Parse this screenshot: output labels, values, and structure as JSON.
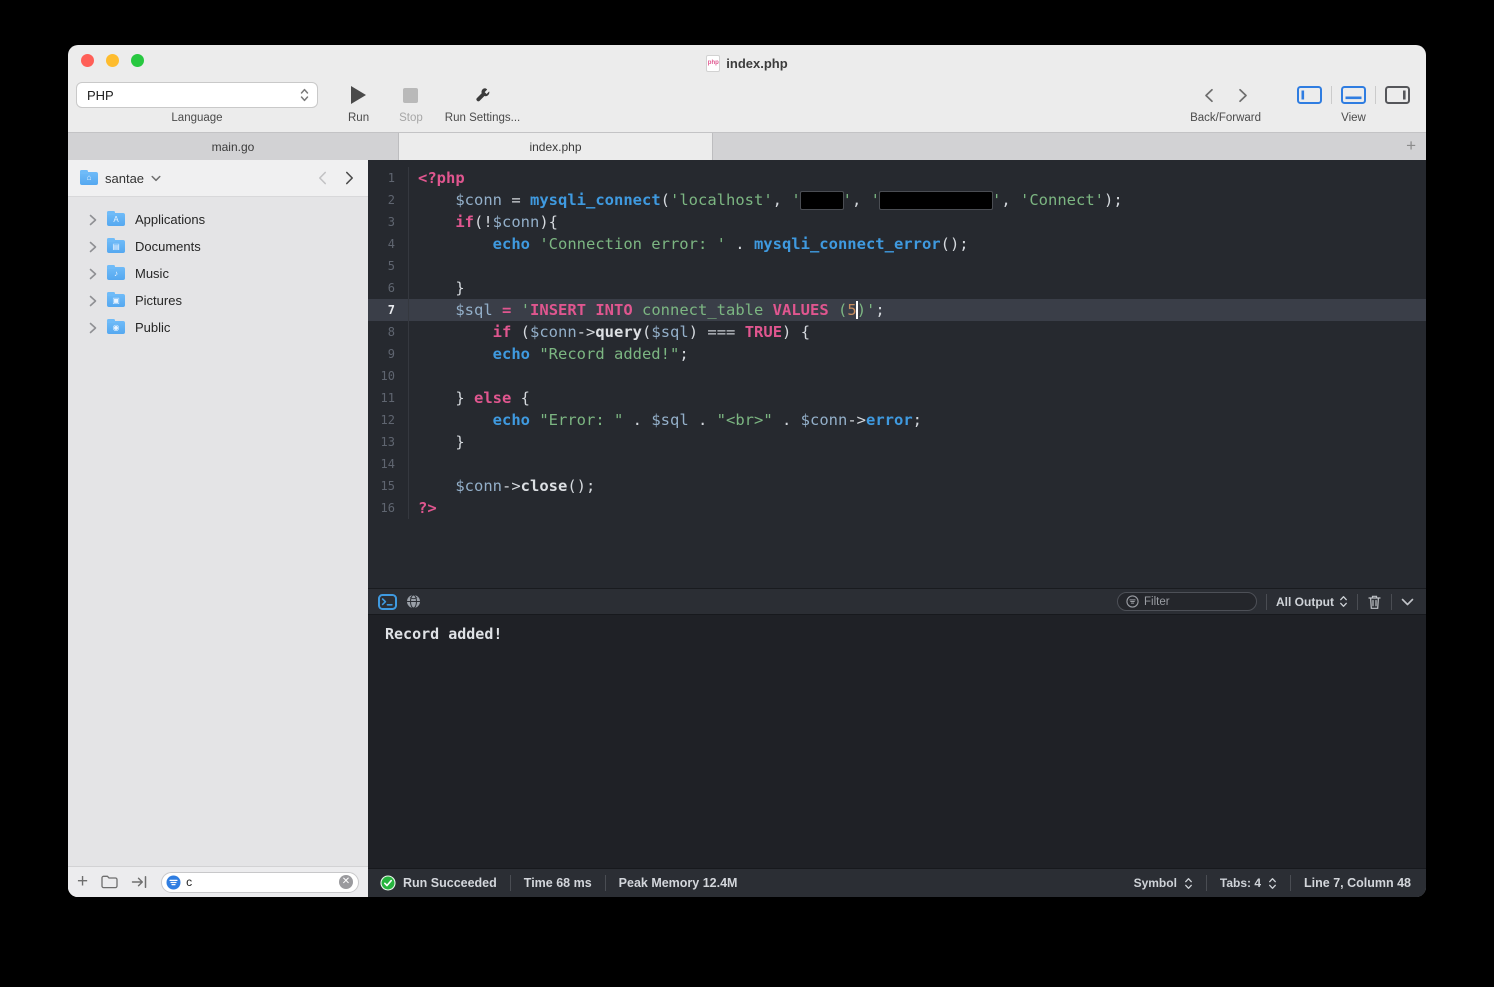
{
  "window": {
    "title": "index.php",
    "file_icon_label": "php"
  },
  "toolbar": {
    "language_value": "PHP",
    "language_label": "Language",
    "run_label": "Run",
    "stop_label": "Stop",
    "run_settings_label": "Run Settings...",
    "back_forward_label": "Back/Forward",
    "view_label": "View"
  },
  "tabs": [
    {
      "label": "main.go",
      "active": false
    },
    {
      "label": "index.php",
      "active": true
    }
  ],
  "tab_add_label": "+",
  "sidebar": {
    "root_label": "santae",
    "items": [
      {
        "label": "Applications",
        "glyph": "A"
      },
      {
        "label": "Documents",
        "glyph": "▤"
      },
      {
        "label": "Music",
        "glyph": "♪"
      },
      {
        "label": "Pictures",
        "glyph": "▣"
      },
      {
        "label": "Public",
        "glyph": "◉"
      }
    ],
    "home_glyph": "⌂",
    "filter_value": "c"
  },
  "editor": {
    "current_line": 7,
    "lines": [
      {
        "n": 1,
        "tokens": [
          {
            "c": "k",
            "t": "<?php"
          }
        ]
      },
      {
        "n": 2,
        "tokens": [
          {
            "c": "p",
            "t": "    "
          },
          {
            "c": "v",
            "t": "$conn"
          },
          {
            "c": "p",
            "t": " = "
          },
          {
            "c": "f",
            "t": "mysqli_connect"
          },
          {
            "c": "p",
            "t": "("
          },
          {
            "c": "s",
            "t": "'localhost'"
          },
          {
            "c": "p",
            "t": ", "
          },
          {
            "c": "s",
            "t": "'"
          },
          {
            "c": "redact",
            "w": "4.5ch"
          },
          {
            "c": "s",
            "t": "'"
          },
          {
            "c": "p",
            "t": ", "
          },
          {
            "c": "s",
            "t": "'"
          },
          {
            "c": "redact",
            "w": "12ch"
          },
          {
            "c": "s",
            "t": "'"
          },
          {
            "c": "p",
            "t": ", "
          },
          {
            "c": "s",
            "t": "'Connect'"
          },
          {
            "c": "p",
            "t": ");"
          }
        ]
      },
      {
        "n": 3,
        "tokens": [
          {
            "c": "p",
            "t": "    "
          },
          {
            "c": "k",
            "t": "if"
          },
          {
            "c": "p",
            "t": "(!"
          },
          {
            "c": "v",
            "t": "$conn"
          },
          {
            "c": "p",
            "t": "){"
          }
        ]
      },
      {
        "n": 4,
        "tokens": [
          {
            "c": "p",
            "t": "        "
          },
          {
            "c": "f",
            "t": "echo"
          },
          {
            "c": "p",
            "t": " "
          },
          {
            "c": "s",
            "t": "'Connection error: '"
          },
          {
            "c": "p",
            "t": " . "
          },
          {
            "c": "f",
            "t": "mysqli_connect_error"
          },
          {
            "c": "p",
            "t": "();"
          }
        ]
      },
      {
        "n": 5,
        "tokens": []
      },
      {
        "n": 6,
        "tokens": [
          {
            "c": "p",
            "t": "    }"
          }
        ]
      },
      {
        "n": 7,
        "tokens": [
          {
            "c": "p",
            "t": "    "
          },
          {
            "c": "v",
            "t": "$sql"
          },
          {
            "c": "p",
            "t": " "
          },
          {
            "c": "k",
            "t": "="
          },
          {
            "c": "p",
            "t": " "
          },
          {
            "c": "s",
            "t": "'"
          },
          {
            "c": "q",
            "t": "INSERT INTO"
          },
          {
            "c": "s",
            "t": " connect_table "
          },
          {
            "c": "q",
            "t": "VALUES"
          },
          {
            "c": "s",
            "t": " ("
          },
          {
            "c": "n",
            "t": "5"
          },
          {
            "c": "cursor"
          },
          {
            "c": "s",
            "t": ")'"
          },
          {
            "c": "p",
            "t": ";"
          }
        ]
      },
      {
        "n": 8,
        "tokens": [
          {
            "c": "p",
            "t": "        "
          },
          {
            "c": "k",
            "t": "if"
          },
          {
            "c": "p",
            "t": " ("
          },
          {
            "c": "v",
            "t": "$conn"
          },
          {
            "c": "p",
            "t": "->"
          },
          {
            "c": "m",
            "t": "query"
          },
          {
            "c": "p",
            "t": "("
          },
          {
            "c": "v",
            "t": "$sql"
          },
          {
            "c": "p",
            "t": ") "
          },
          {
            "c": "o",
            "t": "==="
          },
          {
            "c": "p",
            "t": " "
          },
          {
            "c": "k",
            "t": "TRUE"
          },
          {
            "c": "p",
            "t": ") {"
          }
        ]
      },
      {
        "n": 9,
        "tokens": [
          {
            "c": "p",
            "t": "        "
          },
          {
            "c": "f",
            "t": "echo"
          },
          {
            "c": "p",
            "t": " "
          },
          {
            "c": "s",
            "t": "\"Record added!\""
          },
          {
            "c": "p",
            "t": ";"
          }
        ]
      },
      {
        "n": 10,
        "tokens": []
      },
      {
        "n": 11,
        "tokens": [
          {
            "c": "p",
            "t": "    } "
          },
          {
            "c": "k",
            "t": "else"
          },
          {
            "c": "p",
            "t": " {"
          }
        ]
      },
      {
        "n": 12,
        "tokens": [
          {
            "c": "p",
            "t": "        "
          },
          {
            "c": "f",
            "t": "echo"
          },
          {
            "c": "p",
            "t": " "
          },
          {
            "c": "s",
            "t": "\"Error: \""
          },
          {
            "c": "p",
            "t": " . "
          },
          {
            "c": "v",
            "t": "$sql"
          },
          {
            "c": "p",
            "t": " . "
          },
          {
            "c": "s",
            "t": "\"<br>\""
          },
          {
            "c": "p",
            "t": " . "
          },
          {
            "c": "v",
            "t": "$conn"
          },
          {
            "c": "p",
            "t": "->"
          },
          {
            "c": "f",
            "t": "error"
          },
          {
            "c": "p",
            "t": ";"
          }
        ]
      },
      {
        "n": 13,
        "tokens": [
          {
            "c": "p",
            "t": "    }"
          }
        ]
      },
      {
        "n": 14,
        "tokens": []
      },
      {
        "n": 15,
        "tokens": [
          {
            "c": "p",
            "t": "    "
          },
          {
            "c": "v",
            "t": "$conn"
          },
          {
            "c": "p",
            "t": "->"
          },
          {
            "c": "m",
            "t": "close"
          },
          {
            "c": "p",
            "t": "();"
          }
        ]
      },
      {
        "n": 16,
        "tokens": [
          {
            "c": "k",
            "t": "?>"
          }
        ]
      }
    ]
  },
  "console": {
    "output": "Record added!",
    "filter_placeholder": "Filter",
    "output_mode": "All Output"
  },
  "status_bar": {
    "run_status": "Run Succeeded",
    "time": "Time 68 ms",
    "memory": "Peak Memory 12.4M",
    "symbol_label": "Symbol",
    "tabs_label": "Tabs: 4",
    "position": "Line 7, Column 48"
  },
  "colors": {
    "accent_blue": "#3f9ae0",
    "keyword_pink": "#e0568f",
    "string_green": "#7cb682",
    "variable_blue": "#93afc9",
    "number_orange": "#c88d5f",
    "editor_bg": "#26292f",
    "line_highlight": "#3a3e48",
    "console_bg": "#1f2126",
    "panel_bg": "#2b2e34",
    "chrome_bg": "#ececec",
    "tab_inactive": "#d2d2d4",
    "sidebar_bg": "#e4e4e6",
    "sidebar_header_bg": "#f0f0f1",
    "status_green": "#27b43e",
    "folder_blue": "#55a8f0"
  }
}
